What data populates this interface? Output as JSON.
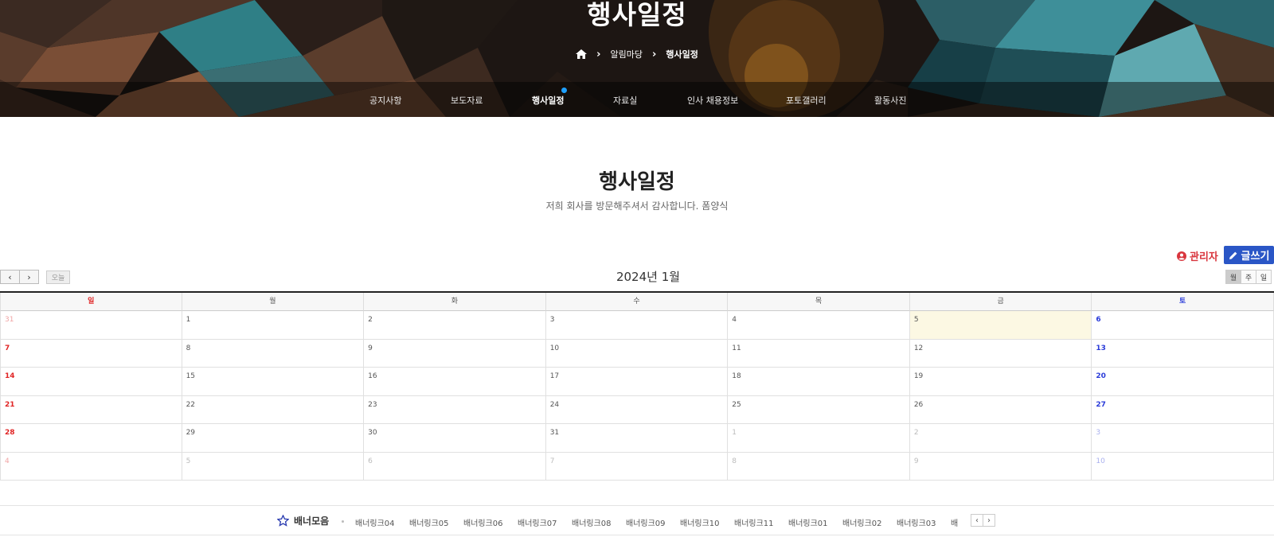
{
  "hero": {
    "title": "행사일정",
    "breadcrumb": {
      "section": "알림마당",
      "current": "행사일정"
    }
  },
  "subnav": {
    "items": [
      {
        "label": "공지사항"
      },
      {
        "label": "보도자료"
      },
      {
        "label": "행사일정",
        "active": true
      },
      {
        "label": "자료실"
      },
      {
        "label": "인사 채용정보"
      },
      {
        "label": "포토갤러리"
      },
      {
        "label": "활동사진"
      }
    ]
  },
  "page": {
    "title": "행사일정",
    "subtitle": "저희 회사를 방문해주셔서 감사합니다. 폼양식"
  },
  "admin": {
    "label": "관리자",
    "write_label": "글쓰기"
  },
  "calendar": {
    "title": "2024년 1월",
    "today_label": "오늘",
    "views": [
      "월",
      "주",
      "일"
    ],
    "weekdays": [
      "일",
      "월",
      "화",
      "수",
      "목",
      "금",
      "토"
    ],
    "weeks": [
      [
        "31",
        "1",
        "2",
        "3",
        "4",
        "5",
        "6"
      ],
      [
        "7",
        "8",
        "9",
        "10",
        "11",
        "12",
        "13"
      ],
      [
        "14",
        "15",
        "16",
        "17",
        "18",
        "19",
        "20"
      ],
      [
        "21",
        "22",
        "23",
        "24",
        "25",
        "26",
        "27"
      ],
      [
        "28",
        "29",
        "30",
        "31",
        "1",
        "2",
        "3"
      ],
      [
        "4",
        "5",
        "6",
        "7",
        "8",
        "9",
        "10"
      ]
    ],
    "today": "5"
  },
  "banner": {
    "label": "배너모음",
    "items": [
      "배너링크04",
      "배너링크05",
      "배너링크06",
      "배너링크07",
      "배너링크08",
      "배너링크09",
      "배너링크10",
      "배너링크11",
      "배너링크01",
      "배너링크02",
      "배너링크03",
      "배"
    ]
  },
  "colors": {
    "accent": "#2a56c6",
    "admin": "#d9363e",
    "sunday": "#e02424",
    "saturday": "#2a3bd9",
    "today_bg": "#fcf8e3"
  }
}
